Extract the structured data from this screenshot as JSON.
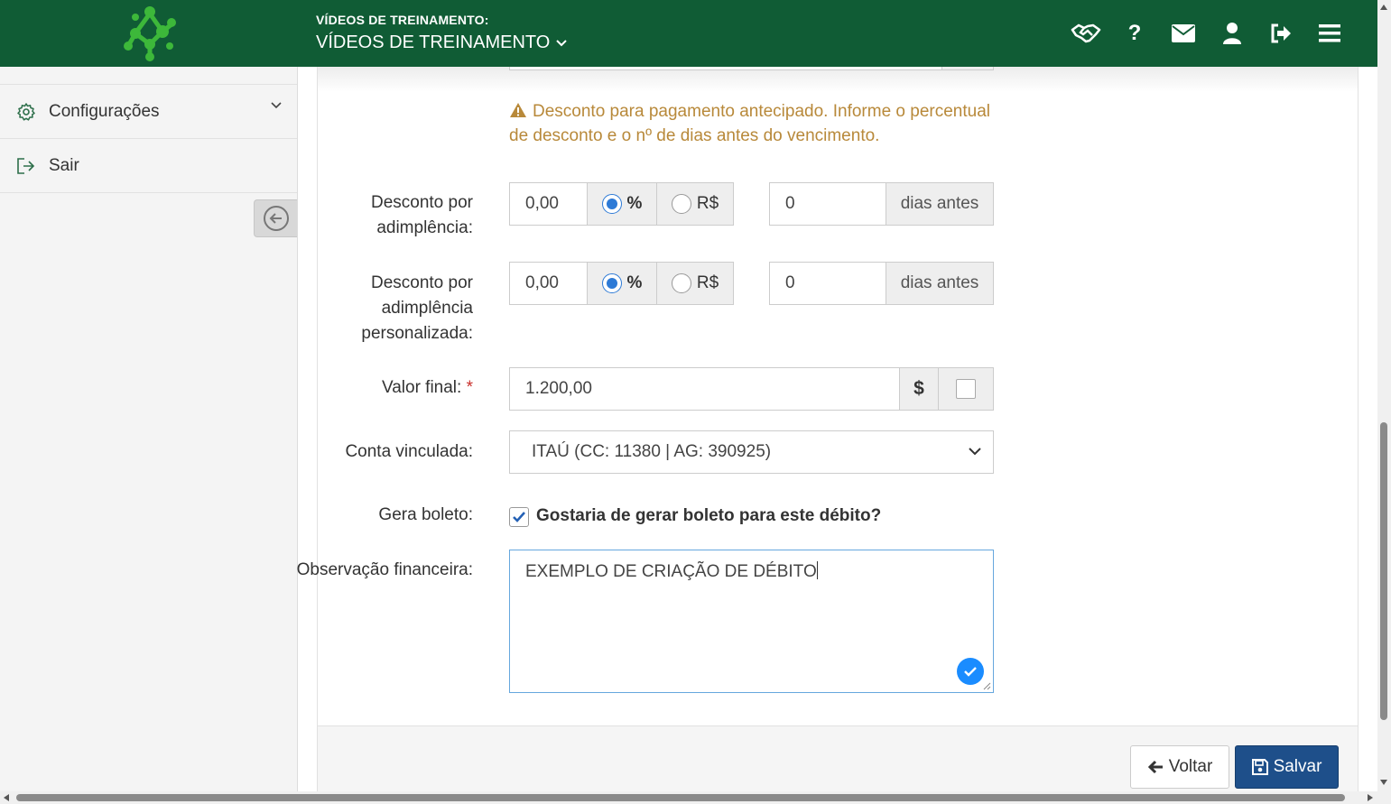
{
  "header": {
    "subtitle": "VÍDEOS DE TREINAMENTO:",
    "title": "VÍDEOS DE TREINAMENTO",
    "bg_color": "#105c35",
    "icons": [
      "handshake-icon",
      "help-icon",
      "mail-icon",
      "user-icon",
      "logout-icon",
      "menu-icon"
    ]
  },
  "sidebar": {
    "items": [
      {
        "label": "Configurações",
        "icon": "gear-icon"
      },
      {
        "label": "Sair",
        "icon": "sign-out-icon"
      }
    ]
  },
  "form": {
    "warning": "Desconto para pagamento antecipado. Informe o percentual de desconto e o nº de dias antes do vencimento.",
    "desconto_adimplencia": {
      "label": "Desconto por adimplência:",
      "value": "0,00",
      "opt_percent": "%",
      "opt_currency": "R$",
      "selected": "%",
      "days": "0",
      "days_suffix": "dias antes"
    },
    "desconto_personalizada": {
      "label": "Desconto por adimplência personalizada:",
      "value": "0,00",
      "opt_percent": "%",
      "opt_currency": "R$",
      "selected": "%",
      "days": "0",
      "days_suffix": "dias antes"
    },
    "valor_final": {
      "label": "Valor final:",
      "required_mark": "*",
      "value": "1.200,00",
      "addon": "$"
    },
    "conta_vinculada": {
      "label": "Conta vinculada:",
      "selected": "ITAÚ (CC: 11380 | AG: 390925)"
    },
    "gera_boleto": {
      "label": "Gera boleto:",
      "checkbox_label": "Gostaria de gerar boleto para este débito?",
      "checked": true
    },
    "observacao": {
      "label": "Observação financeira:",
      "value": "EXEMPLO DE CRIAÇÃO DE DÉBITO"
    }
  },
  "footer": {
    "back_label": "Voltar",
    "save_label": "Salvar"
  }
}
